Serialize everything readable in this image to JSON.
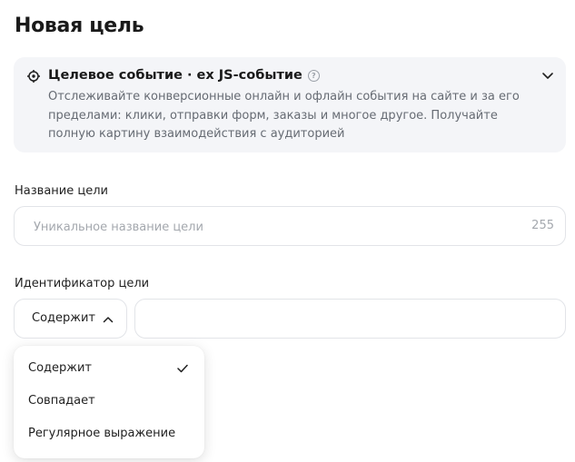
{
  "page": {
    "title": "Новая цель"
  },
  "goal_type": {
    "title": "Целевое событие · ex JS-событие",
    "help_glyph": "?",
    "description": "Отслеживайте конверсионные онлайн и офлайн события на сайте и за его пределами: клики, отправки форм, заказы и многое другое. Получайте полную картину взаимодействия с аудиторией",
    "icons": {
      "leading": "target-icon",
      "help": "help-icon",
      "toggle": "chevron-down-icon"
    }
  },
  "goal_name": {
    "label": "Название цели",
    "value": "",
    "placeholder": "Уникальное название цели",
    "counter": "255"
  },
  "goal_identifier": {
    "label": "Идентификатор цели",
    "match_type": "Содержит",
    "value": "",
    "icons": {
      "toggle": "chevron-up-icon"
    }
  },
  "match_dropdown": {
    "options": [
      {
        "label": "Содержит",
        "selected": true
      },
      {
        "label": "Совпадает",
        "selected": false
      },
      {
        "label": "Регулярное выражение",
        "selected": false
      }
    ],
    "selected_icon": "check-icon"
  },
  "colors": {
    "card_background": "#f4f5f8",
    "border": "#e2e4e8",
    "muted_text": "#666b73",
    "placeholder": "#a4a8ae"
  }
}
